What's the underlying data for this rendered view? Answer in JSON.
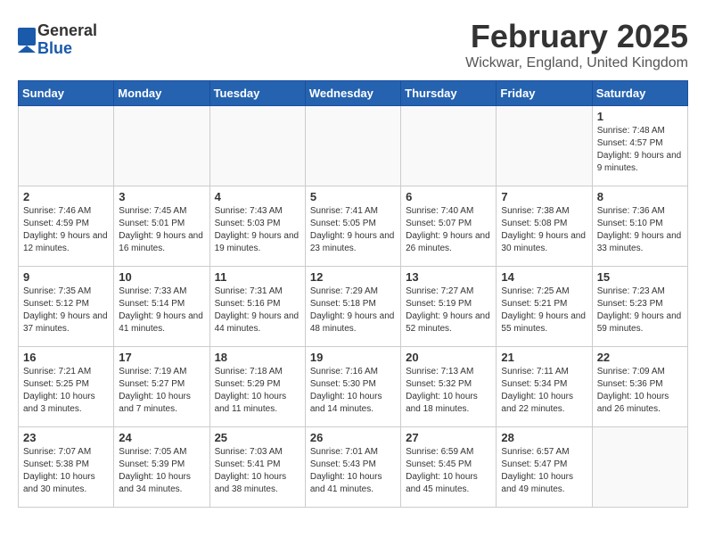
{
  "header": {
    "logo_general": "General",
    "logo_blue": "Blue",
    "month_title": "February 2025",
    "location": "Wickwar, England, United Kingdom"
  },
  "weekdays": [
    "Sunday",
    "Monday",
    "Tuesday",
    "Wednesday",
    "Thursday",
    "Friday",
    "Saturday"
  ],
  "weeks": [
    [
      {
        "day": "",
        "info": ""
      },
      {
        "day": "",
        "info": ""
      },
      {
        "day": "",
        "info": ""
      },
      {
        "day": "",
        "info": ""
      },
      {
        "day": "",
        "info": ""
      },
      {
        "day": "",
        "info": ""
      },
      {
        "day": "1",
        "info": "Sunrise: 7:48 AM\nSunset: 4:57 PM\nDaylight: 9 hours and 9 minutes."
      }
    ],
    [
      {
        "day": "2",
        "info": "Sunrise: 7:46 AM\nSunset: 4:59 PM\nDaylight: 9 hours and 12 minutes."
      },
      {
        "day": "3",
        "info": "Sunrise: 7:45 AM\nSunset: 5:01 PM\nDaylight: 9 hours and 16 minutes."
      },
      {
        "day": "4",
        "info": "Sunrise: 7:43 AM\nSunset: 5:03 PM\nDaylight: 9 hours and 19 minutes."
      },
      {
        "day": "5",
        "info": "Sunrise: 7:41 AM\nSunset: 5:05 PM\nDaylight: 9 hours and 23 minutes."
      },
      {
        "day": "6",
        "info": "Sunrise: 7:40 AM\nSunset: 5:07 PM\nDaylight: 9 hours and 26 minutes."
      },
      {
        "day": "7",
        "info": "Sunrise: 7:38 AM\nSunset: 5:08 PM\nDaylight: 9 hours and 30 minutes."
      },
      {
        "day": "8",
        "info": "Sunrise: 7:36 AM\nSunset: 5:10 PM\nDaylight: 9 hours and 33 minutes."
      }
    ],
    [
      {
        "day": "9",
        "info": "Sunrise: 7:35 AM\nSunset: 5:12 PM\nDaylight: 9 hours and 37 minutes."
      },
      {
        "day": "10",
        "info": "Sunrise: 7:33 AM\nSunset: 5:14 PM\nDaylight: 9 hours and 41 minutes."
      },
      {
        "day": "11",
        "info": "Sunrise: 7:31 AM\nSunset: 5:16 PM\nDaylight: 9 hours and 44 minutes."
      },
      {
        "day": "12",
        "info": "Sunrise: 7:29 AM\nSunset: 5:18 PM\nDaylight: 9 hours and 48 minutes."
      },
      {
        "day": "13",
        "info": "Sunrise: 7:27 AM\nSunset: 5:19 PM\nDaylight: 9 hours and 52 minutes."
      },
      {
        "day": "14",
        "info": "Sunrise: 7:25 AM\nSunset: 5:21 PM\nDaylight: 9 hours and 55 minutes."
      },
      {
        "day": "15",
        "info": "Sunrise: 7:23 AM\nSunset: 5:23 PM\nDaylight: 9 hours and 59 minutes."
      }
    ],
    [
      {
        "day": "16",
        "info": "Sunrise: 7:21 AM\nSunset: 5:25 PM\nDaylight: 10 hours and 3 minutes."
      },
      {
        "day": "17",
        "info": "Sunrise: 7:19 AM\nSunset: 5:27 PM\nDaylight: 10 hours and 7 minutes."
      },
      {
        "day": "18",
        "info": "Sunrise: 7:18 AM\nSunset: 5:29 PM\nDaylight: 10 hours and 11 minutes."
      },
      {
        "day": "19",
        "info": "Sunrise: 7:16 AM\nSunset: 5:30 PM\nDaylight: 10 hours and 14 minutes."
      },
      {
        "day": "20",
        "info": "Sunrise: 7:13 AM\nSunset: 5:32 PM\nDaylight: 10 hours and 18 minutes."
      },
      {
        "day": "21",
        "info": "Sunrise: 7:11 AM\nSunset: 5:34 PM\nDaylight: 10 hours and 22 minutes."
      },
      {
        "day": "22",
        "info": "Sunrise: 7:09 AM\nSunset: 5:36 PM\nDaylight: 10 hours and 26 minutes."
      }
    ],
    [
      {
        "day": "23",
        "info": "Sunrise: 7:07 AM\nSunset: 5:38 PM\nDaylight: 10 hours and 30 minutes."
      },
      {
        "day": "24",
        "info": "Sunrise: 7:05 AM\nSunset: 5:39 PM\nDaylight: 10 hours and 34 minutes."
      },
      {
        "day": "25",
        "info": "Sunrise: 7:03 AM\nSunset: 5:41 PM\nDaylight: 10 hours and 38 minutes."
      },
      {
        "day": "26",
        "info": "Sunrise: 7:01 AM\nSunset: 5:43 PM\nDaylight: 10 hours and 41 minutes."
      },
      {
        "day": "27",
        "info": "Sunrise: 6:59 AM\nSunset: 5:45 PM\nDaylight: 10 hours and 45 minutes."
      },
      {
        "day": "28",
        "info": "Sunrise: 6:57 AM\nSunset: 5:47 PM\nDaylight: 10 hours and 49 minutes."
      },
      {
        "day": "",
        "info": ""
      }
    ]
  ]
}
